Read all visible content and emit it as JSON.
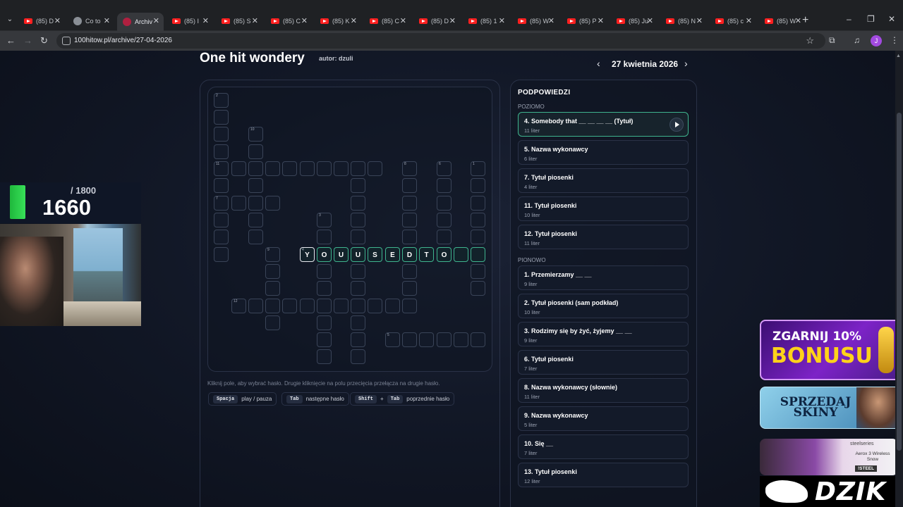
{
  "browser": {
    "tabs": [
      {
        "label": "(85) D",
        "icon": "youtube-icon"
      },
      {
        "label": "Co to",
        "icon": "globe-icon"
      },
      {
        "label": "Archiv",
        "icon": "site-icon",
        "active": true
      },
      {
        "label": "(85) I",
        "icon": "youtube-icon"
      },
      {
        "label": "(85) S",
        "icon": "youtube-icon"
      },
      {
        "label": "(85) C",
        "icon": "youtube-icon"
      },
      {
        "label": "(85) K",
        "icon": "youtube-icon"
      },
      {
        "label": "(85) C",
        "icon": "youtube-icon"
      },
      {
        "label": "(85) D",
        "icon": "youtube-icon"
      },
      {
        "label": "(85) 1",
        "icon": "youtube-icon"
      },
      {
        "label": "(85) W",
        "icon": "youtube-icon"
      },
      {
        "label": "(85) P",
        "icon": "youtube-icon"
      },
      {
        "label": "(85) Ju",
        "icon": "youtube-icon"
      },
      {
        "label": "(85) N",
        "icon": "youtube-icon"
      },
      {
        "label": "(85) c",
        "icon": "youtube-icon"
      },
      {
        "label": "(85) W",
        "icon": "youtube-icon"
      }
    ],
    "url": "100hitow.pl/archive/27-04-2026",
    "profile_initial": "J"
  },
  "page": {
    "title": "One hit wondery",
    "author": "autor: dzuli",
    "date": "27 kwietnia 2026"
  },
  "crossword": {
    "current_word": [
      "Y",
      "O",
      "U",
      "U",
      "S",
      "E",
      "D",
      "T",
      "O",
      "",
      ""
    ],
    "numbers": {
      "n1": "1",
      "n2": "2",
      "n3": "3",
      "n4": "4",
      "n5": "5",
      "n6": "6",
      "n7": "7",
      "n8": "8",
      "n9": "9",
      "n10": "10",
      "n11": "11",
      "n12": "12",
      "n13": "13"
    }
  },
  "instructions": {
    "hint": "Kliknij pole, aby wybrać hasło. Drugie kliknięcie na polu przecięcia przełącza na drugie hasło.",
    "shortcuts": [
      {
        "keys": [
          "Spacja"
        ],
        "label": "play / pauza"
      },
      {
        "keys": [
          "Tab"
        ],
        "label": "następne hasło"
      },
      {
        "keys": [
          "Shift",
          "Tab"
        ],
        "label": "poprzednie hasło",
        "joiner": "+"
      }
    ]
  },
  "clues": {
    "title": "PODPOWIEDZI",
    "across_label": "POZIOMO",
    "down_label": "PIONOWO",
    "across": [
      {
        "text": "4. Somebody that __ __ __ __ (Tytuł)",
        "len": "11 liter",
        "selected": true
      },
      {
        "text": "5. Nazwa wykonawcy",
        "len": "6 liter"
      },
      {
        "text": "7. Tytuł piosenki",
        "len": "4 liter"
      },
      {
        "text": "11. Tytuł piosenki",
        "len": "10 liter"
      },
      {
        "text": "12. Tytuł piosenki",
        "len": "11 liter"
      }
    ],
    "down": [
      {
        "text": "1. Przemierzamy __ __",
        "len": "9 liter"
      },
      {
        "text": "2. Tytuł piosenki (sam podkład)",
        "len": "10 liter"
      },
      {
        "text": "3. Rodzimy się by żyć, żyjemy __ __",
        "len": "9 liter"
      },
      {
        "text": "6. Tytuł piosenki",
        "len": "7 liter"
      },
      {
        "text": "8. Nazwa wykonawcy (słownie)",
        "len": "11 liter"
      },
      {
        "text": "9. Nazwa wykonawcy",
        "len": "5 liter"
      },
      {
        "text": "10. Się __",
        "len": "7 liter"
      },
      {
        "text": "13. Tytuł piosenki",
        "len": "12 liter"
      }
    ]
  },
  "overlay": {
    "score_total": "/ 1800",
    "score_current": "1660",
    "promo1_line1": "ZGARNIJ 10%",
    "promo1_line2": "BONUSU",
    "promo2_text": "SPRZEDAJ SKINY",
    "promo3_brand": "steelseries",
    "promo3_product": "Aerox 3 Wireless Snow",
    "promo3_code": "!STEEL",
    "promo4_text": "DZIK"
  },
  "colors": {
    "accent": "#3fb48e",
    "background": "#0e1320",
    "score_green": "#38e058",
    "promo_yellow": "#ffd21a"
  }
}
